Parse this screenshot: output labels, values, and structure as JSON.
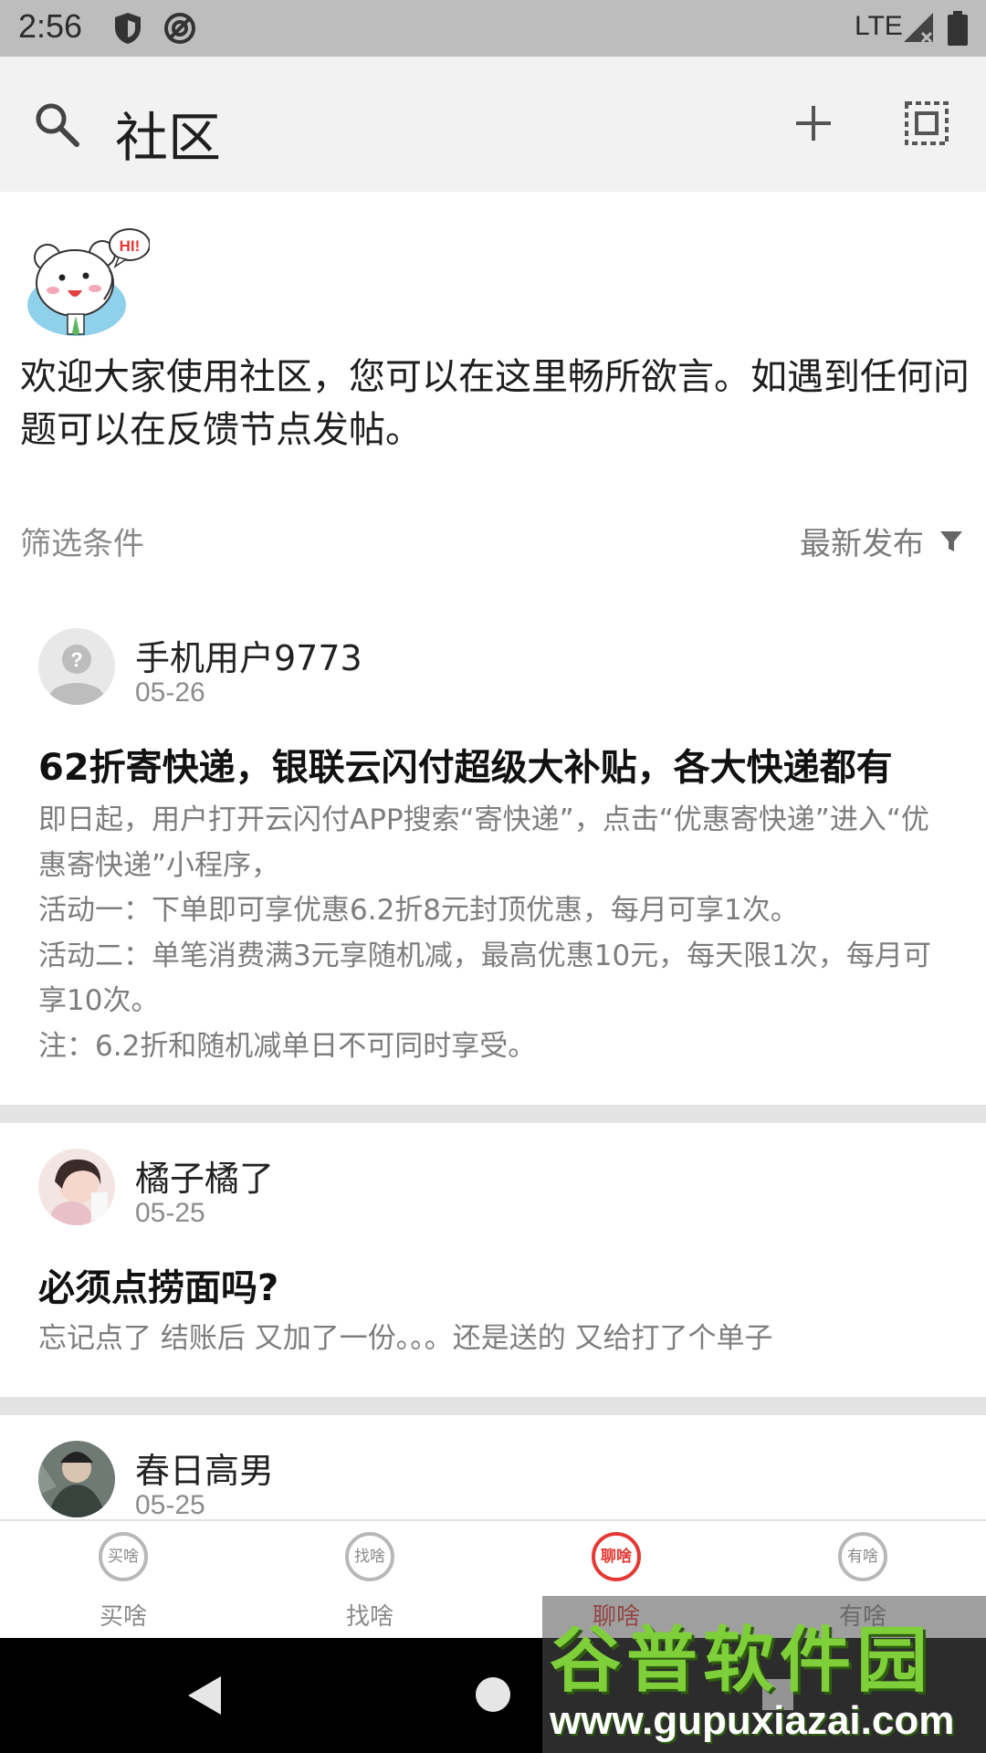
{
  "status_bar": {
    "time": "2:56",
    "network": "LTE"
  },
  "header": {
    "title": "社区"
  },
  "intro": {
    "text": "欢迎大家使用社区，您可以在这里畅所欲言。如遇到任何问题可以在反馈节点发帖。",
    "mascot_text": "HI!"
  },
  "filter": {
    "label": "筛选条件",
    "sort_label": "最新发布"
  },
  "posts": [
    {
      "author": "手机用户9773",
      "date": "05-26",
      "title": "62折寄快递，银联云闪付超级大补贴，各大快递都有",
      "body": "即日起，用户打开云闪付APP搜索“寄快递”，点击“优惠寄快递”进入“优惠寄快递”小程序，\n活动一：下单即可享优惠6.2折8元封顶优惠，每月可享1次。\n活动二：单笔消费满3元享随机减，最高优惠10元，每天限1次，每月可享10次。\n注：6.2折和随机减单日不可同时享受。"
    },
    {
      "author": "橘子橘了",
      "date": "05-25",
      "title": "必须点捞面吗?",
      "body": "忘记点了 结账后 又加了一份。。。还是送的 又给打了个单子"
    },
    {
      "author": "春日高男",
      "date": "05-25"
    }
  ],
  "bottom_nav": {
    "items": [
      {
        "label": "买啥",
        "icon_text": "买啥"
      },
      {
        "label": "找啥",
        "icon_text": "找啥"
      },
      {
        "label": "聊啥",
        "icon_text": "聊啥"
      },
      {
        "label": "有啥",
        "icon_text": "有啥"
      }
    ],
    "active_index": 2,
    "active_color": "#e53935"
  },
  "watermark": {
    "title": "谷普软件园",
    "url": "www.gupuxiazai.com"
  }
}
